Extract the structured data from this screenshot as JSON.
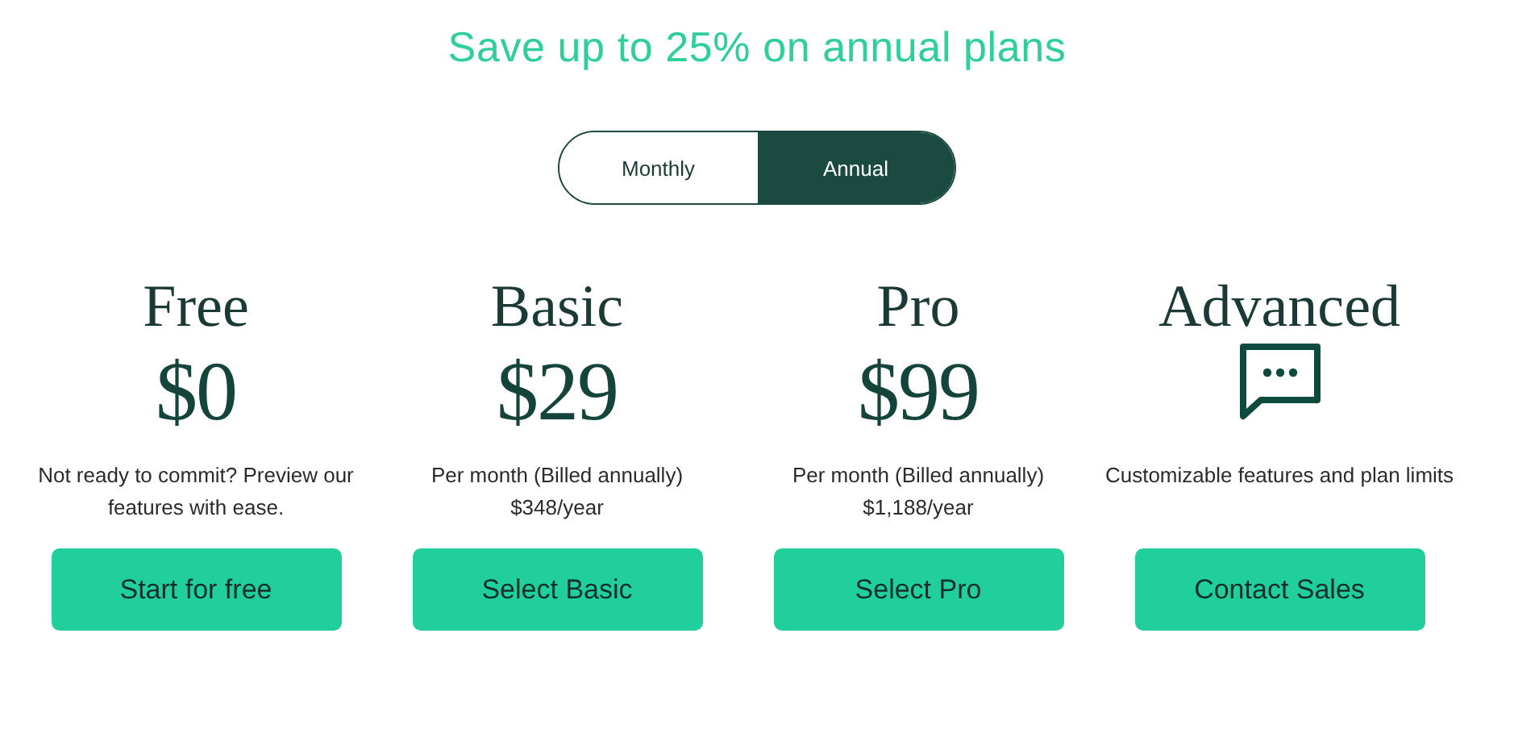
{
  "headline": "Save up to 25% on annual plans",
  "billing_toggle": [
    {
      "label": "Monthly",
      "selected": false
    },
    {
      "label": "Annual",
      "selected": true
    }
  ],
  "plans": [
    {
      "kind": "price",
      "name": "Free",
      "price": "$0",
      "description": [
        "Not ready to commit? Preview our features with ease."
      ],
      "button": "Start for free"
    },
    {
      "kind": "price",
      "name": "Basic",
      "price": "$29",
      "description": [
        "Per month (Billed annually)",
        "$348/year"
      ],
      "button": "Select Basic"
    },
    {
      "kind": "price",
      "name": "Pro",
      "price": "$99",
      "description": [
        "Per month (Billed annually)",
        "$1,188/year"
      ],
      "button": "Select Pro"
    },
    {
      "kind": "contact",
      "name": "Advanced",
      "description": [
        "Customizable features and plan limits"
      ],
      "button": "Contact Sales"
    }
  ]
}
